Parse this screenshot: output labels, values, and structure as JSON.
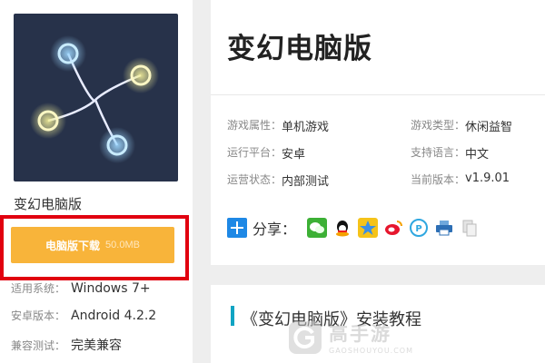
{
  "product": {
    "name": "变幻电脑版",
    "download_label": "电脑版下载",
    "download_size": "50.0MB",
    "specs": [
      {
        "key": "适用系统：",
        "value": "Windows 7+"
      },
      {
        "key": "安卓版本：",
        "value": "Android 4.2.2"
      },
      {
        "key": "兼容测试：",
        "value": "完美兼容"
      }
    ]
  },
  "detail": {
    "title": "变幻电脑版",
    "attributes": [
      {
        "key": "游戏属性：",
        "value": "单机游戏"
      },
      {
        "key": "游戏类型：",
        "value": "休闲益智"
      },
      {
        "key": "运行平台：",
        "value": "安卓"
      },
      {
        "key": "支持语言：",
        "value": "中文"
      },
      {
        "key": "运营状态：",
        "value": "内部测试"
      },
      {
        "key": "当前版本：",
        "value": "v1.9.01"
      }
    ],
    "share_label": "分享：",
    "share_icons": [
      "wechat-icon",
      "qq-icon",
      "qzone-icon",
      "weibo-icon",
      "tencent-weibo-icon",
      "print-icon",
      "copy-icon"
    ]
  },
  "tutorial": {
    "title": "《变幻电脑版》安装教程"
  },
  "watermark": {
    "main": "高手游",
    "sub": "GAOSHOUYOU.COM"
  },
  "colors": {
    "download_button": "#f8b43a",
    "highlight_frame": "#e1000f",
    "accent_bar": "#11a4c3",
    "icon_background": "#27324a"
  }
}
